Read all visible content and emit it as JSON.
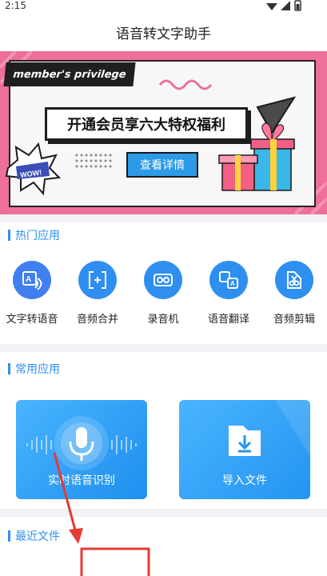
{
  "status_bar": {
    "time": "2:15"
  },
  "header": {
    "title": "语音转文字助手"
  },
  "banner": {
    "member_label": "member's privilege",
    "headline": "开通会员享六大特权福利",
    "button_label": "查看详情",
    "sticker_text": "WOW!"
  },
  "hot_apps": {
    "section_title": "热门应用",
    "items": [
      {
        "label": "文字转语音",
        "icon": "text-to-speech-icon",
        "color": "#3f7ff2"
      },
      {
        "label": "音频合并",
        "icon": "audio-merge-icon",
        "color": "#2e8ff0"
      },
      {
        "label": "录音机",
        "icon": "recorder-icon",
        "color": "#2e8ff0"
      },
      {
        "label": "语音翻译",
        "icon": "voice-translate-icon",
        "color": "#2e8ff0"
      },
      {
        "label": "音频剪辑",
        "icon": "audio-edit-icon",
        "color": "#2e8ff0"
      }
    ]
  },
  "common_apps": {
    "section_title": "常用应用",
    "items": [
      {
        "label": "实时语音识别",
        "icon": "microphone-icon"
      },
      {
        "label": "导入文件",
        "icon": "import-file-icon"
      }
    ]
  },
  "recent_files": {
    "section_title": "最近文件"
  },
  "colors": {
    "accent": "#2e8ff0",
    "banner_pink": "#ee6f98",
    "annotation_red": "#e53935"
  }
}
